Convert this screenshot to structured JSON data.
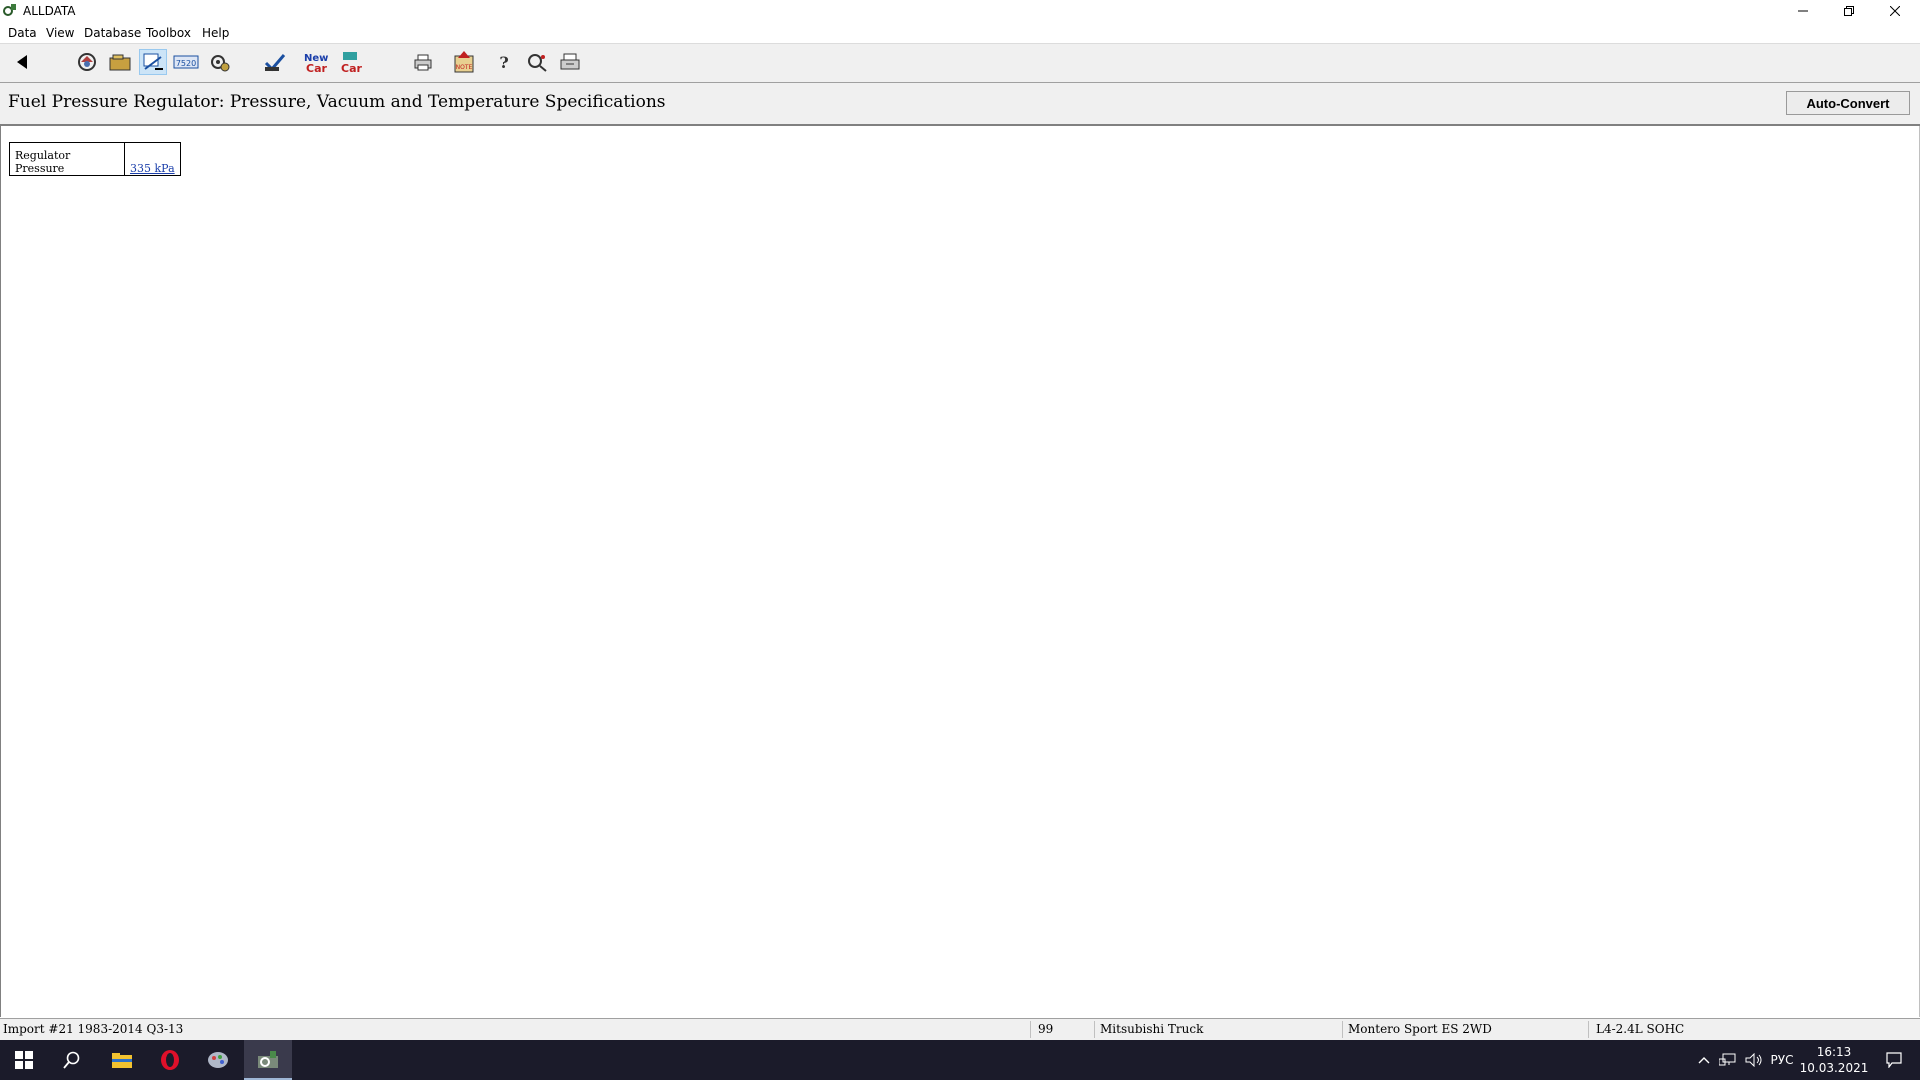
{
  "window": {
    "title": "ALLDATA"
  },
  "menu": [
    "Data",
    "View",
    "Database",
    "Toolbox",
    "Help"
  ],
  "toolbar": {
    "icons": [
      "back-arrow-icon",
      "component-locator-icon",
      "folder-icon",
      "specifications-icon",
      "labor-guide-icon",
      "engine-icon",
      "tsb-icon",
      "new-car-icon",
      "new-car-2-icon",
      "print-icon",
      "note-icon",
      "help-icon",
      "search-icon",
      "print-preview-icon"
    ],
    "new_car_label": "New Car"
  },
  "page": {
    "heading": "Fuel Pressure Regulator:  Pressure, Vacuum and Temperature Specifications",
    "auto_convert_label": "Auto-Convert"
  },
  "spec_table": {
    "rows": [
      {
        "label": "Regulator Pressure",
        "value": "335 kPa"
      }
    ]
  },
  "status": {
    "database": "Import #21 1983-2014 Q3-13",
    "year": "99",
    "make": "Mitsubishi Truck",
    "model": "Montero Sport ES  2WD",
    "engine": "L4-2.4L SOHC"
  },
  "taskbar": {
    "apps": [
      "windows-start-icon",
      "search-icon",
      "file-explorer-icon",
      "opera-icon",
      "app-icon",
      "alldata-icon"
    ],
    "language": "РУС",
    "time": "16:13",
    "date": "10.03.2021"
  },
  "colors": {
    "link": "#1a3eaa",
    "taskbar": "#1b1b2a",
    "toolbar_bg": "#f0f0f0"
  }
}
